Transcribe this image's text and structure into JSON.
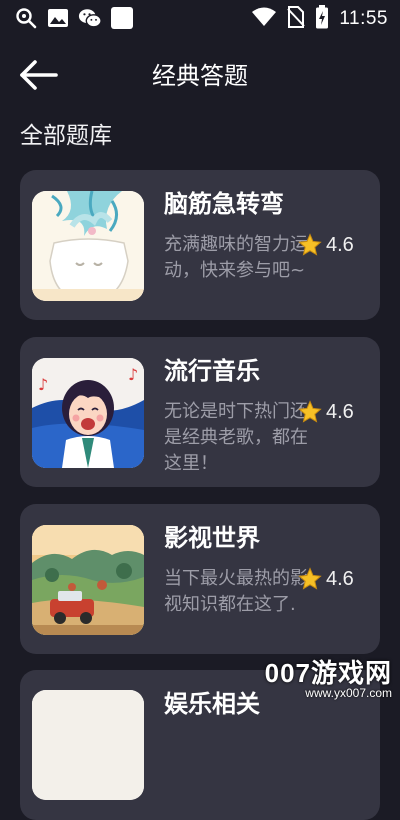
{
  "status_bar": {
    "time": "11:55",
    "left_icons": [
      "search-status-icon",
      "image-icon",
      "wechat-icon",
      "blank-square-icon"
    ],
    "right_icons": [
      "wifi-icon",
      "no-sim-icon",
      "battery-charging-icon"
    ]
  },
  "header": {
    "title": "经典答题",
    "back_icon": "arrow-left-icon"
  },
  "section": {
    "title": "全部题库"
  },
  "cards": [
    {
      "title": "脑筋急转弯",
      "description": "充满趣味的智力运动，快来参与吧~",
      "rating": "4.6",
      "thumb": "cloud-head-illustration"
    },
    {
      "title": "流行音乐",
      "description": "无论是时下热门还是经典老歌，都在这里！",
      "rating": "4.6",
      "thumb": "singing-girl-illustration"
    },
    {
      "title": "影视世界",
      "description": "当下最火最热的影视知识都在这了.",
      "rating": "4.6",
      "thumb": "car-landscape-illustration"
    },
    {
      "title": "娱乐相关",
      "description": "",
      "rating": "",
      "thumb": "partial-illustration"
    }
  ],
  "watermark": {
    "brand": "007游戏网",
    "url": "www.yx007.com"
  },
  "colors": {
    "background": "#1b1b25",
    "card": "#353542",
    "desc_text": "#9d9da8",
    "star": "#f6c026"
  }
}
